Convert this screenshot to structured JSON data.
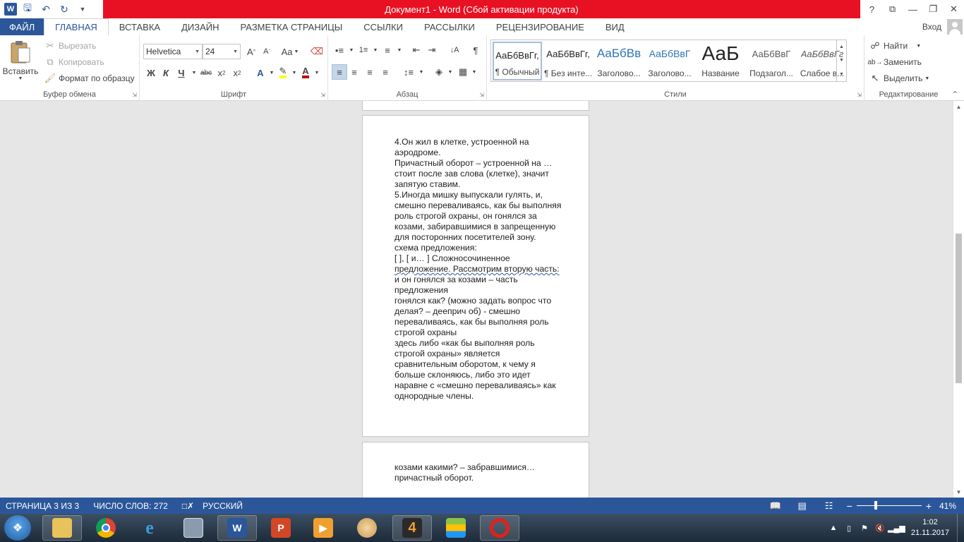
{
  "window": {
    "title": "Документ1 -  Word (Сбой активации продукта)",
    "controls": [
      "?",
      "⧉",
      "—",
      "❐",
      "✕"
    ]
  },
  "qat": {
    "icons": [
      "word-logo",
      "save-icon",
      "undo-icon",
      "redo-icon",
      "customize-icon"
    ]
  },
  "tabs": [
    "ФАЙЛ",
    "ГЛАВНАЯ",
    "ВСТАВКА",
    "ДИЗАЙН",
    "РАЗМЕТКА СТРАНИЦЫ",
    "ССЫЛКИ",
    "РАССЫЛКИ",
    "РЕЦЕНЗИРОВАНИЕ",
    "ВИД"
  ],
  "active_tab": "ГЛАВНАЯ",
  "signin": "Вход",
  "clipboard": {
    "label": "Буфер обмена",
    "paste": "Вставить",
    "cut": "Вырезать",
    "copy": "Копировать",
    "format_painter": "Формат по образцу"
  },
  "font": {
    "label": "Шрифт",
    "family": "Helvetica",
    "size": "24"
  },
  "paragraph": {
    "label": "Абзац"
  },
  "styles": {
    "label": "Стили",
    "items": [
      {
        "sample": "АаБбВвГг,",
        "name": "¶ Обычный"
      },
      {
        "sample": "АаБбВвГг,",
        "name": "¶ Без инте..."
      },
      {
        "sample": "АаБбВв",
        "name": "Заголово..."
      },
      {
        "sample": "АаБбВвГ",
        "name": "Заголово..."
      },
      {
        "sample": "АаБ",
        "name": "Название"
      },
      {
        "sample": "АаБбВвГ",
        "name": "Подзагол..."
      },
      {
        "sample": "АаБбВвГг",
        "name": "Слабое в..."
      }
    ]
  },
  "editing": {
    "label": "Редактирование",
    "find": "Найти",
    "replace": "Заменить",
    "select": "Выделить"
  },
  "document": {
    "page3_lines": [
      "4.Он жил в клетке, устроенной на",
      "аэродроме.",
      "Причастный оборот – устроенной на …",
      "стоит после зав слова (клетке), значит",
      "запятую ставим.",
      "5.Иногда мишку выпускали гулять, и,",
      "смешно переваливаясь, как бы выполняя",
      "роль строгой охраны, он гонялся за",
      "козами, забиравшимися в запрещенную",
      "для посторонних посетителей зону.",
      "схема предложения:",
      "[ ], [ и… ] Сложносочиненное",
      "предложение. Рассмотрим вторую часть:",
      "и он гонялся за козами – часть",
      "предложения",
      "гонялся как? (можно задать вопрос что",
      "делая? – дееприч об) - смешно",
      "переваливаясь, как бы выполняя роль",
      "строгой охраны",
      "здесь либо «как бы выполняя роль",
      "строгой охраны» является",
      "сравнительным оборотом, к чему я",
      "больше склоняюсь, либо это идет",
      "наравне с «смешно переваливаясь» как",
      "однородные члены."
    ],
    "page4_lines": [
      "козами какими? – забравшимися…",
      "причастный оборот."
    ]
  },
  "status": {
    "page": "СТРАНИЦА 3 ИЗ 3",
    "words": "ЧИСЛО СЛОВ: 272",
    "language": "РУССКИЙ",
    "zoom": "41%",
    "zoom_fraction": 0.41
  },
  "taskbar": {
    "apps": [
      "explorer",
      "chrome",
      "internet-explorer",
      "calculator",
      "word",
      "powerpoint",
      "media-player",
      "paint",
      "game-4",
      "bluestacks",
      "opera"
    ],
    "time": "1:02",
    "date": "21.11.2017"
  },
  "colors": {
    "word_blue": "#2b579a",
    "title_error_red": "#e81123"
  }
}
